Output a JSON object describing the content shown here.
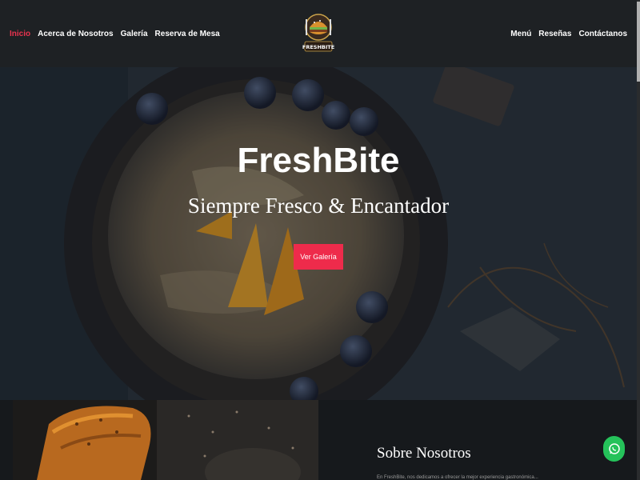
{
  "nav": {
    "left": [
      {
        "label": "Inicio"
      },
      {
        "label": "Acerca de Nosotros"
      },
      {
        "label": "Galería"
      },
      {
        "label": "Reserva de Mesa"
      }
    ],
    "right": [
      {
        "label": "Menú"
      },
      {
        "label": "Reseñas"
      },
      {
        "label": "Contáctanos"
      }
    ],
    "logo_text": "FRESHBITE"
  },
  "hero": {
    "title": "FreshBite",
    "subtitle": "Siempre Fresco & Encantador",
    "button_label": "Ver Galería"
  },
  "about": {
    "heading": "Sobre Nosotros",
    "text": "En FreshBite, nos dedicamos a ofrecer la mejor experiencia gastronómica..."
  },
  "colors": {
    "accent": "#ee2b4b",
    "nav_bg": "#1e2124",
    "whatsapp": "#25c25a"
  },
  "icons": {
    "whatsapp": "whatsapp-icon"
  }
}
